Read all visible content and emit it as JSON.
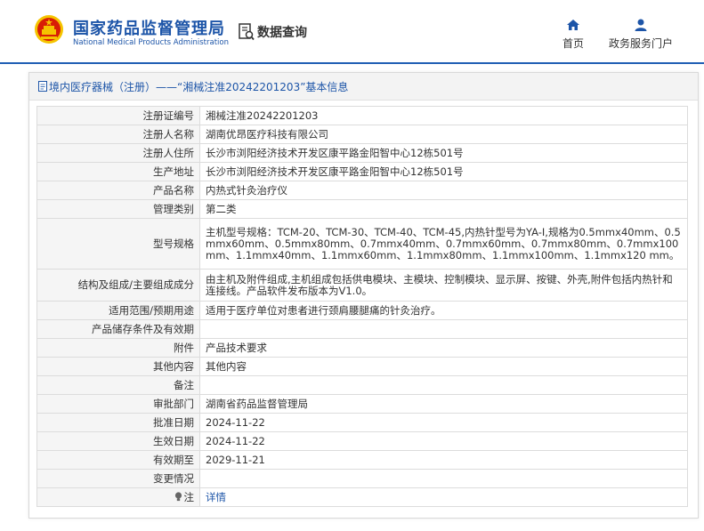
{
  "header": {
    "site_name_cn": "国家药品监督管理局",
    "site_name_en": "National Medical Products Administration",
    "query_label": "数据查询",
    "nav": [
      {
        "label": "首页",
        "icon": "home-icon"
      },
      {
        "label": "政务服务门户",
        "icon": "user-icon"
      }
    ]
  },
  "colors": {
    "brand": "#1d55a8",
    "emblem_red": "#d81e06",
    "emblem_gold": "#f5c400"
  },
  "panel": {
    "breadcrumb": "境内医疗器械（注册）——“湘械注准20242201203”基本信息"
  },
  "fields": [
    {
      "label": "注册证编号",
      "value": "湘械注准20242201203"
    },
    {
      "label": "注册人名称",
      "value": "湖南优昂医疗科技有限公司"
    },
    {
      "label": "注册人住所",
      "value": "长沙市浏阳经济技术开发区康平路金阳智中心12栋501号"
    },
    {
      "label": "生产地址",
      "value": "长沙市浏阳经济技术开发区康平路金阳智中心12栋501号"
    },
    {
      "label": "产品名称",
      "value": "内热式针灸治疗仪"
    },
    {
      "label": "管理类别",
      "value": "第二类"
    },
    {
      "label": "型号规格",
      "value": "主机型号规格：TCM-20、TCM-30、TCM-40、TCM-45,内热针型号为YA-Ⅰ,规格为0.5mmx40mm、0.5mmx60mm、0.5mmx80mm、0.7mmx40mm、0.7mmx60mm、0.7mmx80mm、0.7mmx100mm、1.1mmx40mm、1.1mmx60mm、1.1mmx80mm、1.1mmx100mm、1.1mmx120 mm。"
    },
    {
      "label": "结构及组成/主要组成成分",
      "value": "由主机及附件组成,主机组成包括供电模块、主模块、控制模块、显示屏、按键、外壳,附件包括内热针和连接线。产品软件发布版本为V1.0。"
    },
    {
      "label": "适用范围/预期用途",
      "value": "适用于医疗单位对患者进行颈肩腰腿痛的针灸治疗。"
    },
    {
      "label": "产品储存条件及有效期",
      "value": ""
    },
    {
      "label": "附件",
      "value": "产品技术要求"
    },
    {
      "label": "其他内容",
      "value": "其他内容"
    },
    {
      "label": "备注",
      "value": ""
    },
    {
      "label": "审批部门",
      "value": "湖南省药品监督管理局"
    },
    {
      "label": "批准日期",
      "value": "2024-11-22"
    },
    {
      "label": "生效日期",
      "value": "2024-11-22"
    },
    {
      "label": "有效期至",
      "value": "2029-11-21"
    },
    {
      "label": "变更情况",
      "value": ""
    }
  ],
  "note": {
    "label": "注",
    "link": "详情"
  }
}
